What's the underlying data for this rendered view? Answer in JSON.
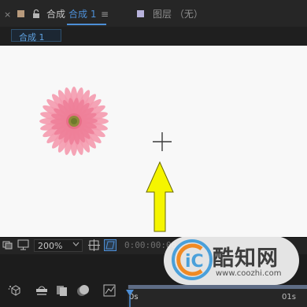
{
  "tabbar": {
    "close_glyph": "×",
    "comp_label": "合成",
    "comp_name": "合成 1",
    "menu_glyph": "≡",
    "layer_label": "图层 （无）",
    "comp_color": "#b89a7c",
    "layer_color": "#b8b3dc",
    "accent": "#4d8fd6"
  },
  "breadcrumb": {
    "label": "合成 1"
  },
  "viewer": {
    "background": "#f8f8f8",
    "arrow_color": "#f5f500"
  },
  "viewbar": {
    "zoom": "200%",
    "timecode": "0:00:00:00"
  },
  "timeline": {
    "start_label": "0s",
    "end_label": "01s"
  },
  "watermark": {
    "title": "酷知网",
    "url": "www.coozhi.com"
  }
}
